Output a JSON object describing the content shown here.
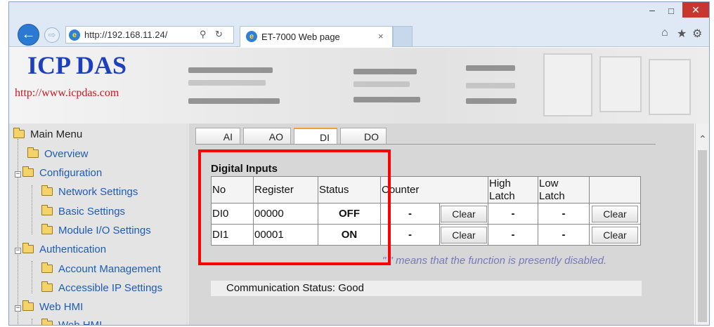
{
  "browser": {
    "url": "http://192.168.11.24/",
    "tab_title": "ET-7000 Web page",
    "back_glyph": "←",
    "forward_glyph": "⇨",
    "search_glyph": "⚲",
    "refresh_glyph": "↻",
    "tab_close": "×",
    "min_glyph": "–",
    "max_glyph": "□",
    "close_glyph": "✕",
    "home_glyph": "⌂",
    "favorites_glyph": "★",
    "settings_glyph": "⚙"
  },
  "header": {
    "brand": "ICP DAS",
    "site_url": "http://www.icpdas.com"
  },
  "sidebar": {
    "root_label": "Main Menu",
    "items": [
      {
        "label": "Overview"
      },
      {
        "label": "Configuration"
      },
      {
        "label": "Network Settings"
      },
      {
        "label": "Basic Settings"
      },
      {
        "label": "Module I/O Settings"
      },
      {
        "label": "Authentication"
      },
      {
        "label": "Account Management"
      },
      {
        "label": "Accessible IP Settings"
      },
      {
        "label": "Web HMI"
      },
      {
        "label": "Web HMI"
      }
    ]
  },
  "tabs": [
    {
      "label": "AI"
    },
    {
      "label": "AO"
    },
    {
      "label": "DI"
    },
    {
      "label": "DO"
    }
  ],
  "active_tab": "DI",
  "digital_inputs": {
    "title": "Digital Inputs",
    "headers": {
      "no": "No",
      "register": "Register",
      "status": "Status",
      "counter": "Counter",
      "high_latch_1": "High",
      "high_latch_2": "Latch",
      "low_latch_1": "Low",
      "low_latch_2": "Latch"
    },
    "rows": [
      {
        "no": "DI0",
        "register": "00000",
        "status": "OFF",
        "counter": "-",
        "clear_counter": "Clear",
        "high_latch": "-",
        "low_latch": "-",
        "clear_latch": "Clear"
      },
      {
        "no": "DI1",
        "register": "00001",
        "status": "ON",
        "counter": "-",
        "clear_counter": "Clear",
        "high_latch": "-",
        "low_latch": "-",
        "clear_latch": "Clear"
      }
    ],
    "note": "\" \" means that the function is presently disabled."
  },
  "communication_status": "Communication Status: Good",
  "colors": {
    "brand": "#1c3fbf",
    "site_url": "#c8181e",
    "link": "#1e5cb3",
    "highlight": "#ff0000",
    "note": "#7878b8",
    "close_button": "#c7372f"
  }
}
